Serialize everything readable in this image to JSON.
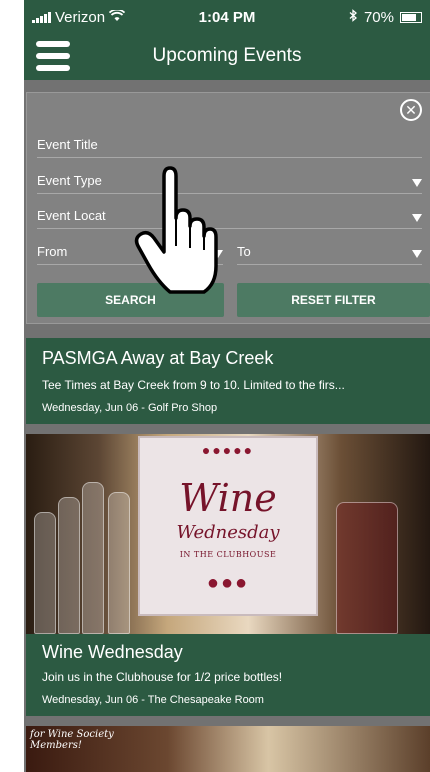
{
  "status_bar": {
    "carrier": "Verizon",
    "time": "1:04 PM",
    "battery": "70%"
  },
  "nav": {
    "title": "Upcoming Events"
  },
  "filter": {
    "event_title": "Event Title",
    "event_type": "Event Type",
    "event_location": "Event Locat",
    "from": "From",
    "to": "To",
    "search_label": "SEARCH",
    "reset_label": "RESET FILTER"
  },
  "events": [
    {
      "title": "PASMGA Away at Bay Creek",
      "desc": "Tee Times at Bay Creek from 9 to 10. Limited to the firs...",
      "meta": "Wednesday, Jun 06 - Golf Pro Shop"
    },
    {
      "title": "Wine Wednesday",
      "desc": "Join us in the Clubhouse for 1/2 price bottles!",
      "meta": "Wednesday, Jun 06 - The Chesapeake Room"
    }
  ],
  "wine_image": {
    "line1": "Wine",
    "line2": "Wednesday",
    "line3": "IN THE CLUBHOUSE"
  },
  "next_thumb": {
    "label_line1": "for Wine Society",
    "label_line2": "Members!"
  },
  "colors": {
    "header_green": "#2c5a42",
    "button_green": "#4d7a63",
    "overlay_gray": "#828282"
  }
}
